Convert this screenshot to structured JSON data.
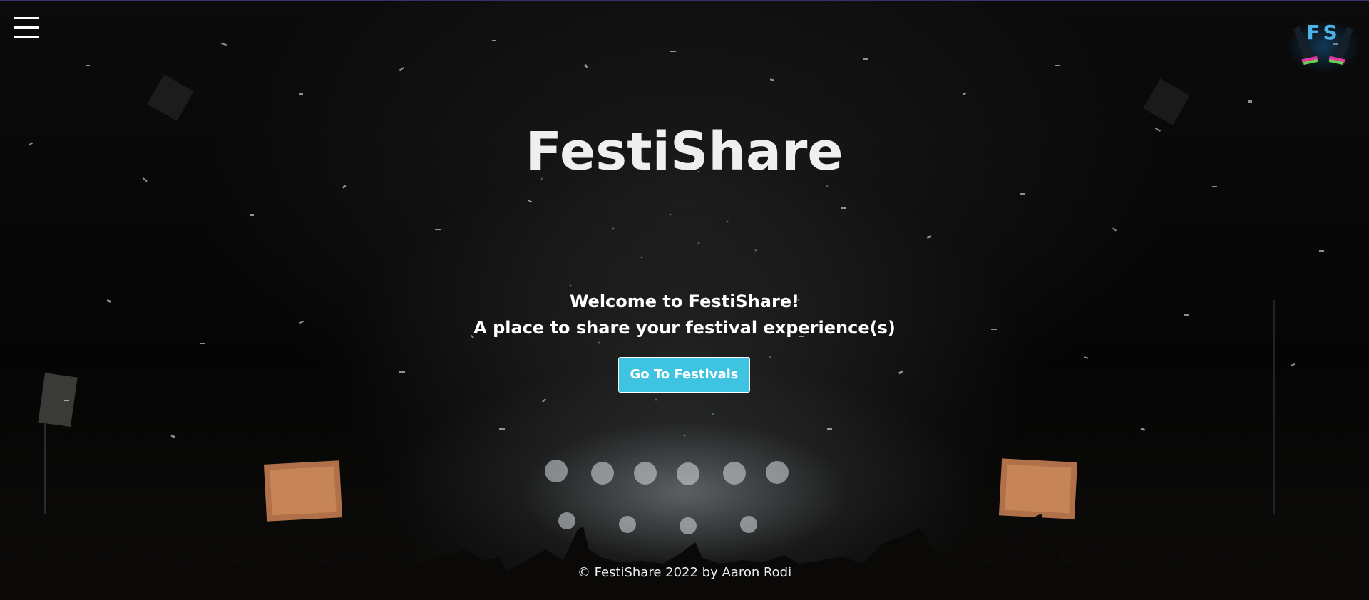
{
  "nav": {
    "menu_icon": "hamburger-menu-icon",
    "logo_text": "FS"
  },
  "hero": {
    "title": "FestiShare",
    "welcome_line1": "Welcome to FestiShare!",
    "welcome_line2": "A place to share your festival experience(s)",
    "cta_label": "Go To Festivals"
  },
  "footer": {
    "copyright": "© FestiShare 2022 by Aaron Rodi"
  },
  "colors": {
    "accent": "#3ec3e0",
    "text": "#ffffff",
    "logo_blue": "#4fb3e8"
  }
}
